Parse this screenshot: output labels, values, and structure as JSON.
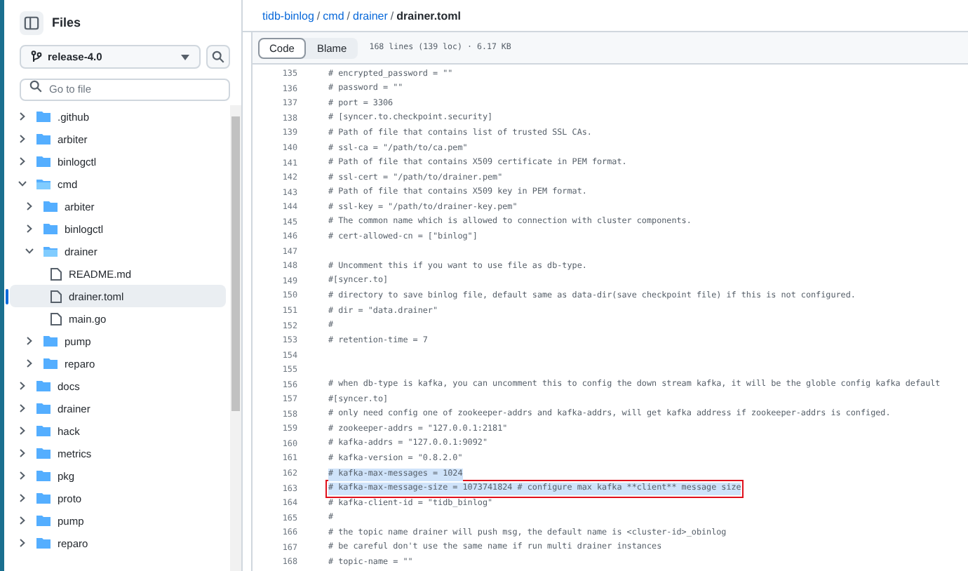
{
  "sidebar": {
    "title": "Files",
    "branch": "release-4.0",
    "search": {
      "placeholder": "Go to file"
    },
    "tree": [
      {
        "kind": "folder",
        "name": ".github",
        "expanded": false,
        "selected": false
      },
      {
        "kind": "folder",
        "name": "arbiter",
        "expanded": false,
        "selected": false
      },
      {
        "kind": "folder",
        "name": "binlogctl",
        "expanded": false,
        "selected": false
      },
      {
        "kind": "folder",
        "name": "cmd",
        "expanded": true,
        "selected": false,
        "children": [
          {
            "kind": "folder",
            "name": "arbiter",
            "expanded": false,
            "selected": false
          },
          {
            "kind": "folder",
            "name": "binlogctl",
            "expanded": false,
            "selected": false
          },
          {
            "kind": "folder",
            "name": "drainer",
            "expanded": true,
            "selected": false,
            "children": [
              {
                "kind": "file",
                "name": "README.md",
                "selected": false
              },
              {
                "kind": "file",
                "name": "drainer.toml",
                "selected": true
              },
              {
                "kind": "file",
                "name": "main.go",
                "selected": false
              }
            ]
          },
          {
            "kind": "folder",
            "name": "pump",
            "expanded": false,
            "selected": false
          },
          {
            "kind": "folder",
            "name": "reparo",
            "expanded": false,
            "selected": false
          }
        ]
      },
      {
        "kind": "folder",
        "name": "docs",
        "expanded": false,
        "selected": false
      },
      {
        "kind": "folder",
        "name": "drainer",
        "expanded": false,
        "selected": false
      },
      {
        "kind": "folder",
        "name": "hack",
        "expanded": false,
        "selected": false
      },
      {
        "kind": "folder",
        "name": "metrics",
        "expanded": false,
        "selected": false
      },
      {
        "kind": "folder",
        "name": "pkg",
        "expanded": false,
        "selected": false
      },
      {
        "kind": "folder",
        "name": "proto",
        "expanded": false,
        "selected": false
      },
      {
        "kind": "folder",
        "name": "pump",
        "expanded": false,
        "selected": false
      },
      {
        "kind": "folder",
        "name": "reparo",
        "expanded": false,
        "selected": false
      }
    ]
  },
  "breadcrumb": [
    {
      "kind": "link",
      "label": "tidb-binlog",
      "current": false
    },
    {
      "kind": "separator",
      "label": "/",
      "current": false
    },
    {
      "kind": "link",
      "label": "cmd",
      "current": false
    },
    {
      "kind": "separator",
      "label": "/",
      "current": false
    },
    {
      "kind": "link",
      "label": "drainer",
      "current": false
    },
    {
      "kind": "separator",
      "label": "/",
      "current": false
    },
    {
      "kind": "link",
      "label": "drainer.toml",
      "current": true
    }
  ],
  "tabs": [
    {
      "label": "Code",
      "selected": true
    },
    {
      "label": "Blame",
      "selected": false
    }
  ],
  "file_info": "168 lines (139 loc) · 6.17 KB",
  "lines": [
    {
      "number": "135",
      "text": "# encrypted_password = \"\"",
      "selected": false,
      "outlined": false
    },
    {
      "number": "136",
      "text": "# password = \"\"",
      "selected": false,
      "outlined": false
    },
    {
      "number": "137",
      "text": "# port = 3306",
      "selected": false,
      "outlined": false
    },
    {
      "number": "138",
      "text": "# [syncer.to.checkpoint.security]",
      "selected": false,
      "outlined": false
    },
    {
      "number": "139",
      "text": "# Path of file that contains list of trusted SSL CAs.",
      "selected": false,
      "outlined": false
    },
    {
      "number": "140",
      "text": "# ssl-ca = \"/path/to/ca.pem\"",
      "selected": false,
      "outlined": false
    },
    {
      "number": "141",
      "text": "# Path of file that contains X509 certificate in PEM format.",
      "selected": false,
      "outlined": false
    },
    {
      "number": "142",
      "text": "# ssl-cert = \"/path/to/drainer.pem\"",
      "selected": false,
      "outlined": false
    },
    {
      "number": "143",
      "text": "# Path of file that contains X509 key in PEM format.",
      "selected": false,
      "outlined": false
    },
    {
      "number": "144",
      "text": "# ssl-key = \"/path/to/drainer-key.pem\"",
      "selected": false,
      "outlined": false
    },
    {
      "number": "145",
      "text": "# The common name which is allowed to connection with cluster components.",
      "selected": false,
      "outlined": false
    },
    {
      "number": "146",
      "text": "# cert-allowed-cn = [\"binlog\"]",
      "selected": false,
      "outlined": false
    },
    {
      "number": "147",
      "selected": false,
      "outlined": false
    },
    {
      "number": "148",
      "text": "# Uncomment this if you want to use file as db-type.",
      "selected": false,
      "outlined": false
    },
    {
      "number": "149",
      "text": "#[syncer.to]",
      "selected": false,
      "outlined": false
    },
    {
      "number": "150",
      "text": "# directory to save binlog file, default same as data-dir(save checkpoint file) if this is not configured.",
      "selected": false,
      "outlined": false
    },
    {
      "number": "151",
      "text": "# dir = \"data.drainer\"",
      "selected": false,
      "outlined": false
    },
    {
      "number": "152",
      "text": "#",
      "selected": false,
      "outlined": false
    },
    {
      "number": "153",
      "text": "# retention-time = 7",
      "selected": false,
      "outlined": false
    },
    {
      "number": "154",
      "selected": false,
      "outlined": false
    },
    {
      "number": "155",
      "selected": false,
      "outlined": false
    },
    {
      "number": "156",
      "text": "# when db-type is kafka, you can uncomment this to config the down stream kafka, it will be the globle config kafka default",
      "selected": false,
      "outlined": false
    },
    {
      "number": "157",
      "text": "#[syncer.to]",
      "selected": false,
      "outlined": false
    },
    {
      "number": "158",
      "text": "# only need config one of zookeeper-addrs and kafka-addrs, will get kafka address if zookeeper-addrs is configed.",
      "selected": false,
      "outlined": false
    },
    {
      "number": "159",
      "text": "# zookeeper-addrs = \"127.0.0.1:2181\"",
      "selected": false,
      "outlined": false
    },
    {
      "number": "160",
      "text": "# kafka-addrs = \"127.0.0.1:9092\"",
      "selected": false,
      "outlined": false
    },
    {
      "number": "161",
      "text": "# kafka-version = \"0.8.2.0\"",
      "selected": false,
      "outlined": false
    },
    {
      "number": "162",
      "text": "# kafka-max-messages = 1024",
      "selected": true,
      "outlined": false
    },
    {
      "number": "163",
      "text": "# kafka-max-message-size = 1073741824 # configure max kafka **client** message size",
      "selected": true,
      "outlined": true
    },
    {
      "number": "164",
      "text": "# kafka-client-id = \"tidb_binlog\"",
      "selected": false,
      "outlined": false
    },
    {
      "number": "165",
      "text": "#",
      "selected": false,
      "outlined": false
    },
    {
      "number": "166",
      "text": "# the topic name drainer will push msg, the default name is <cluster-id>_obinlog",
      "selected": false,
      "outlined": false
    },
    {
      "number": "167",
      "text": "# be careful don't use the same name if run multi drainer instances",
      "selected": false,
      "outlined": false
    },
    {
      "number": "168",
      "text": "# topic-name = \"\"",
      "selected": false,
      "outlined": false
    }
  ]
}
